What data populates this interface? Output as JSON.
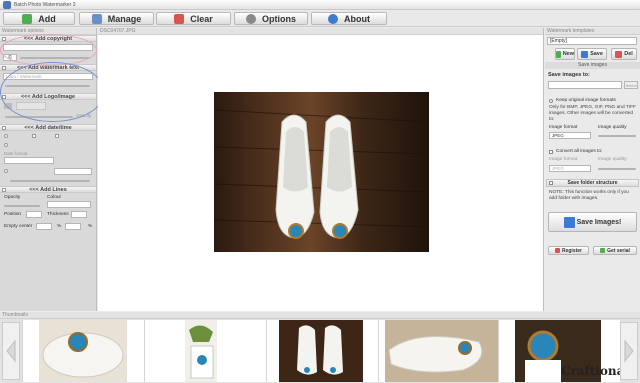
{
  "app": {
    "title": "Batch Photo Watermarker 3"
  },
  "toolbar": {
    "add": "Add",
    "manage": "Manage",
    "clear": "Clear",
    "options": "Options",
    "about": "About"
  },
  "left_panel": {
    "header": "Watermark options",
    "copyright": {
      "title": "<<< Add copyright",
      "font_symbol": "©"
    },
    "watermark_text": {
      "title": "<<< Add watermark text",
      "placeholder": "Logo / Watermark"
    },
    "logo": {
      "title": "<<< Add Logo/Image",
      "opacity": "Opacity"
    },
    "datetime": {
      "title": "<<< Add date/time",
      "date_format": "Date format"
    },
    "lines": {
      "title": "<<< Add Lines",
      "opacity": "Opacity",
      "colour": "Colour",
      "position": "Position",
      "thickness": "Thickness",
      "empty_center": "Empty center",
      "percent": "%"
    }
  },
  "center": {
    "file_name": "DSC04707.JPG"
  },
  "right_panel": {
    "header": "Watermark templates",
    "template_value": "[Empty]",
    "new": "New",
    "save": "Save",
    "del": "Del",
    "save_images_section": "Save images",
    "save_to": "Save images to:",
    "select": "Select",
    "keep_format": "Keep original image formats",
    "note_formats": "Only for BMP, JPEG, GIF, PNG and TIFF images. Other images will be converted to:",
    "image_format": "Image format",
    "image_quality": "Image quality",
    "format_value": "JPEG",
    "convert_all": "Convert all images to:",
    "format_value2": "JPEG",
    "save_folder_structure": "Save folder structure",
    "note_folder": "NOTE: This function works only if you add folder with images.",
    "save_images_btn": "Save Images!",
    "register": "Register",
    "get_serial": "Get serial"
  },
  "thumbnails": {
    "header": "Thumbnails"
  },
  "watermark_brand": "Craftionary",
  "colors": {
    "accent": "#3b7bd1",
    "green": "#4caf50",
    "red": "#d9534f"
  }
}
